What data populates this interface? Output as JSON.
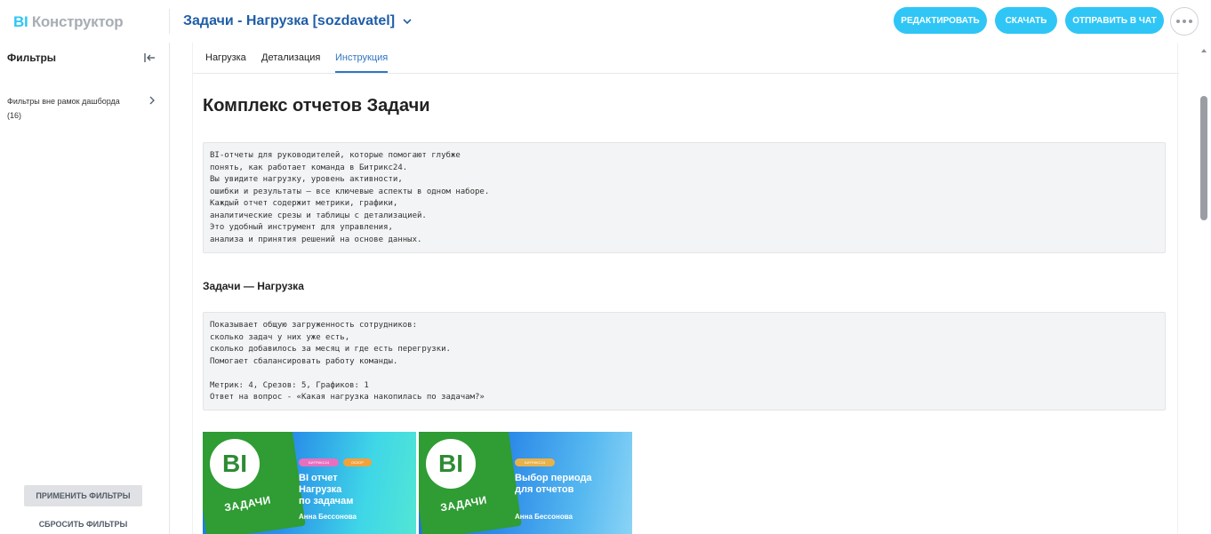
{
  "header": {
    "logo_bi": "BI",
    "logo_rest": "Конструктор",
    "dashboard_title": "Задачи - Нагрузка [sozdavatel]",
    "edit_label": "Редактировать",
    "download_label": "Скачать",
    "send_label": "Отправить в чат"
  },
  "sidebar": {
    "title": "Фильтры",
    "filter_group_label": "Фильтры вне рамок дашборда",
    "filter_group_count": "(16)",
    "apply_label": "Применить фильтры",
    "reset_label": "Сбросить фильтры"
  },
  "tabs": [
    {
      "label": "Нагрузка"
    },
    {
      "label": "Детализация"
    },
    {
      "label": "Инструкция"
    }
  ],
  "content": {
    "heading": "Комплекс отчетов Задачи",
    "intro": "BI-отчеты для руководителей, которые помогают глубже\nпонять, как работает команда в Битрикс24.\nВы увидите нагрузку, уровень активности,\nошибки и результаты — все ключевые аспекты в одном наборе.\nКаждый отчет содержит метрики, графики,\nаналитические срезы и таблицы с детализацией.\nЭто удобный инструмент для управления,\nанализа и принятия решений на основе данных.",
    "section_title": "Задачи — Нагрузка",
    "section_text": "Показывает общую загруженность сотрудников:\nсколько задач у них уже есть,\nсколько добавилось за месяц и где есть перегрузки.\nПомогает сбалансировать работу команды.\n\nМетрик: 4, Срезов: 5, Графиков: 1\nОтвет на вопрос - «Какая нагрузка накопилась по задачам?»"
  },
  "cards": [
    {
      "logo": "BI",
      "tile_label": "ЗАДАЧИ",
      "badge1": "БИТРИКС24",
      "badge2": "ОБЗОР",
      "title": "BI отчет\nНагрузка\nпо задачам",
      "author": "Анна Бессонова"
    },
    {
      "logo": "BI",
      "tile_label": "ЗАДАЧИ",
      "badge1": "БИТРИКС24",
      "title": "Выбор периода\nдля отчетов",
      "author": "Анна Бессонова"
    }
  ],
  "colors": {
    "accent": "#2fc6f6",
    "link": "#2f76c2",
    "title_blue": "#1f5da8",
    "tile_green": "#2f9c34"
  }
}
